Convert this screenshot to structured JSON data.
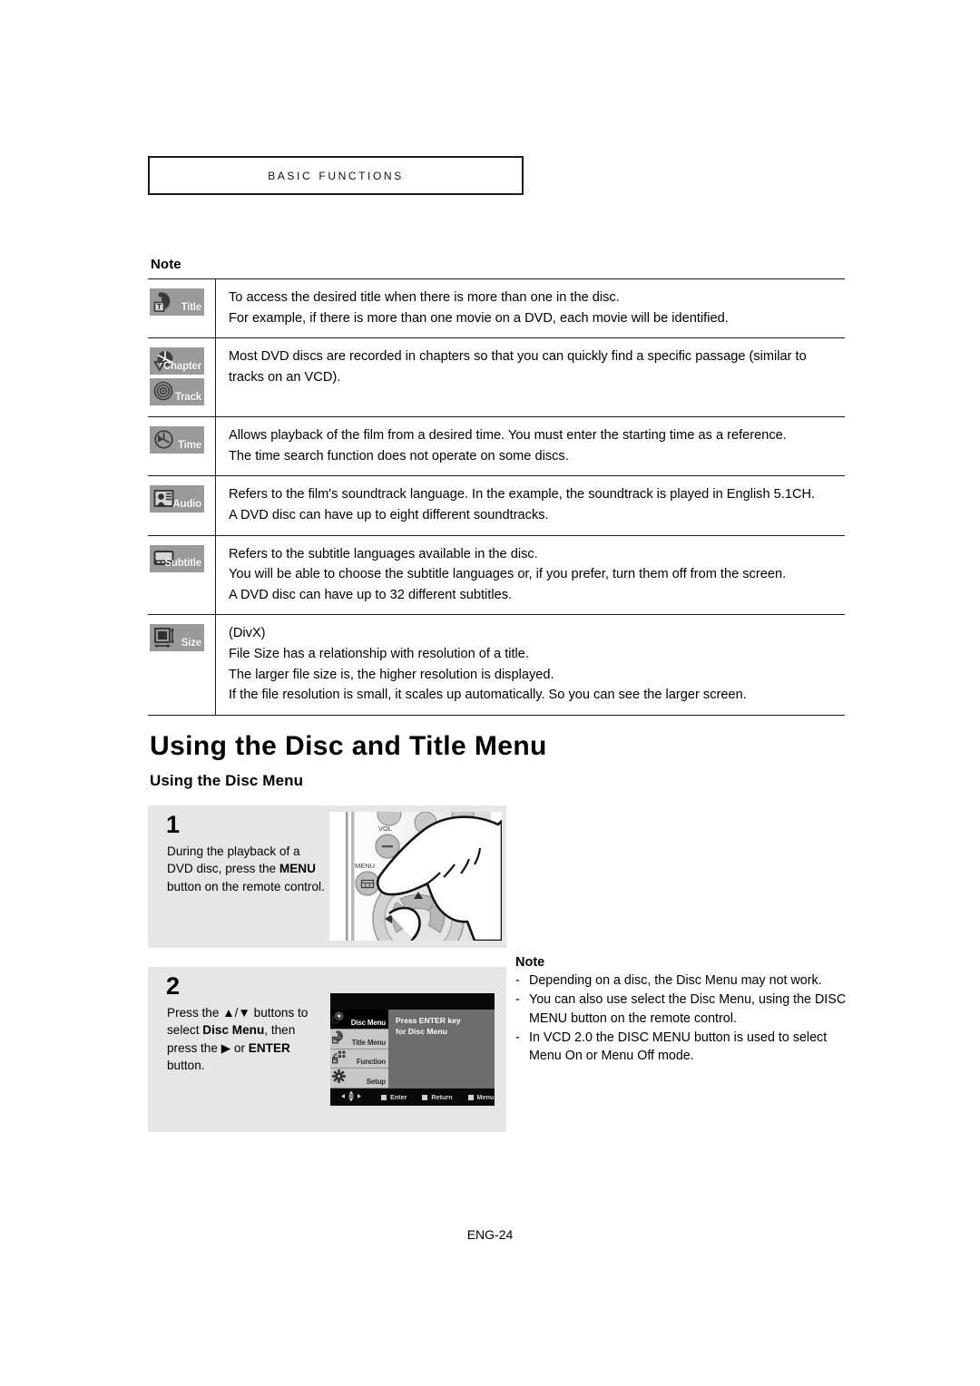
{
  "chapter_header": {
    "title": "Basic Functions"
  },
  "note_table": {
    "label": "Note",
    "rows": [
      {
        "icons": [
          {
            "name": "Title",
            "glyph": "title-icon"
          }
        ],
        "lines": [
          "To access the desired title when there is more than one in the disc.",
          "For example, if there is more than one movie on a DVD, each movie will be identified."
        ]
      },
      {
        "icons": [
          {
            "name": "Chapter",
            "glyph": "chapter-icon"
          },
          {
            "name": "Track",
            "glyph": "track-icon"
          }
        ],
        "lines": [
          "Most DVD discs are recorded in chapters so that you can quickly find a specific passage (similar to",
          "tracks on an VCD)."
        ]
      },
      {
        "icons": [
          {
            "name": "Time",
            "glyph": "time-icon"
          }
        ],
        "lines": [
          "Allows playback of the film from a desired time. You must enter the starting time as a reference.",
          "The time search function does not operate on some discs."
        ]
      },
      {
        "icons": [
          {
            "name": "Audio",
            "glyph": "audio-icon"
          }
        ],
        "lines": [
          "Refers to the film's soundtrack language. In the example, the soundtrack is played in English 5.1CH.",
          "A DVD disc can have up to eight different soundtracks."
        ]
      },
      {
        "icons": [
          {
            "name": "Subtitle",
            "glyph": "subtitle-icon"
          }
        ],
        "lines": [
          "Refers to the subtitle languages available in the disc.",
          "You will be able to choose the subtitle languages or, if you prefer, turn them off from the screen.",
          "A DVD disc can have up to 32 different subtitles."
        ]
      },
      {
        "icons": [
          {
            "name": "Size",
            "glyph": "size-icon"
          }
        ],
        "lines": [
          "(DivX)",
          "File Size has a relationship with resolution of a title.",
          "The larger file size is, the higher resolution is displayed.",
          "If the file resolution is small, it scales up automatically. So you can see the larger screen."
        ]
      }
    ]
  },
  "section": {
    "heading": "Using the Disc and Title Menu",
    "subheading": "Using the Disc Menu"
  },
  "steps": [
    {
      "number": "1",
      "text_html": "During the playback of a DVD disc, press the <b>MENU</b> button on the remote control.",
      "illustration": "remote-control-menu-press"
    },
    {
      "number": "2",
      "text_html": "Press the ▲/▼ buttons to select <b>Disc Menu</b>, then press the ▶ or <b>ENTER</b> button.",
      "illustration": "osd-disc-menu-screen"
    }
  ],
  "remote_illustration": {
    "labels": {
      "vol": "VOL",
      "menu": "MENU"
    }
  },
  "osd": {
    "sidebar": [
      {
        "label": "Disc Menu",
        "glyph": "disc-icon",
        "selected": true
      },
      {
        "label": "Title Menu",
        "glyph": "title-menu-icon",
        "selected": false
      },
      {
        "label": "Function",
        "glyph": "function-icon",
        "selected": false
      },
      {
        "label": "Setup",
        "glyph": "gear-icon",
        "selected": false
      }
    ],
    "content_line_1": "Press ENTER key",
    "content_line_2": "for Disc Menu",
    "bottom_hints": [
      "Enter",
      "Return",
      "Menu"
    ]
  },
  "note_right": {
    "title": "Note",
    "dash": "-",
    "items": [
      "Depending on a disc, the Disc Menu may not work.",
      "You can also use select the Disc Menu, using the DISC MENU button on the remote control.",
      "In VCD 2.0 the DISC MENU button is used to select Menu On or Menu Off mode."
    ]
  },
  "footer": {
    "page": "ENG-24"
  },
  "colors": {
    "badge_gray": "#9a9a9a",
    "panel_gray": "#e6e6e6",
    "osd_gray": "#6d6d6d",
    "osd_black": "#0a0a0a",
    "rule": "#1c1c1c"
  }
}
